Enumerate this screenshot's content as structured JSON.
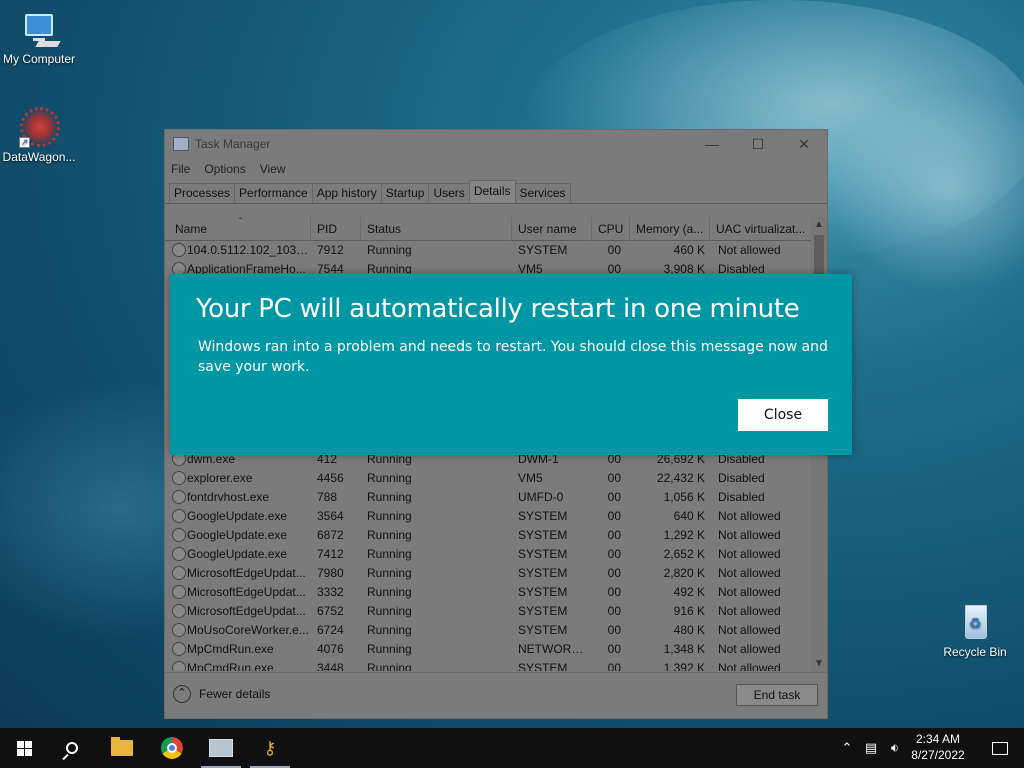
{
  "desktop": {
    "icons": [
      {
        "label": "My Computer"
      },
      {
        "label": "DataWagon..."
      },
      {
        "label": "Recycle Bin"
      }
    ]
  },
  "task_manager": {
    "title": "Task Manager",
    "menu": [
      "File",
      "Options",
      "View"
    ],
    "tabs": [
      "Processes",
      "Performance",
      "App history",
      "Startup",
      "Users",
      "Details",
      "Services"
    ],
    "active_tab": "Details",
    "columns": [
      "Name",
      "PID",
      "Status",
      "User name",
      "CPU",
      "Memory (a...",
      "UAC virtualizat..."
    ],
    "rows": [
      {
        "name": "104.0.5112.102_103.0....",
        "pid": "7912",
        "status": "Running",
        "user": "SYSTEM",
        "cpu": "00",
        "mem": "460 K",
        "uac": "Not allowed"
      },
      {
        "name": "ApplicationFrameHo...",
        "pid": "7544",
        "status": "Running",
        "user": "VM5",
        "cpu": "00",
        "mem": "3,908 K",
        "uac": "Disabled"
      },
      {
        "name": "dwm.exe",
        "pid": "412",
        "status": "Running",
        "user": "DWM-1",
        "cpu": "00",
        "mem": "26,692 K",
        "uac": "Disabled"
      },
      {
        "name": "explorer.exe",
        "pid": "4456",
        "status": "Running",
        "user": "VM5",
        "cpu": "00",
        "mem": "22,432 K",
        "uac": "Disabled"
      },
      {
        "name": "fontdrvhost.exe",
        "pid": "788",
        "status": "Running",
        "user": "UMFD-0",
        "cpu": "00",
        "mem": "1,056 K",
        "uac": "Disabled"
      },
      {
        "name": "GoogleUpdate.exe",
        "pid": "3564",
        "status": "Running",
        "user": "SYSTEM",
        "cpu": "00",
        "mem": "640 K",
        "uac": "Not allowed"
      },
      {
        "name": "GoogleUpdate.exe",
        "pid": "6872",
        "status": "Running",
        "user": "SYSTEM",
        "cpu": "00",
        "mem": "1,292 K",
        "uac": "Not allowed"
      },
      {
        "name": "GoogleUpdate.exe",
        "pid": "7412",
        "status": "Running",
        "user": "SYSTEM",
        "cpu": "00",
        "mem": "2,652 K",
        "uac": "Not allowed"
      },
      {
        "name": "MicrosoftEdgeUpdat...",
        "pid": "7980",
        "status": "Running",
        "user": "SYSTEM",
        "cpu": "00",
        "mem": "2,820 K",
        "uac": "Not allowed"
      },
      {
        "name": "MicrosoftEdgeUpdat...",
        "pid": "3332",
        "status": "Running",
        "user": "SYSTEM",
        "cpu": "00",
        "mem": "492 K",
        "uac": "Not allowed"
      },
      {
        "name": "MicrosoftEdgeUpdat...",
        "pid": "6752",
        "status": "Running",
        "user": "SYSTEM",
        "cpu": "00",
        "mem": "916 K",
        "uac": "Not allowed"
      },
      {
        "name": "MoUsoCoreWorker.e...",
        "pid": "6724",
        "status": "Running",
        "user": "SYSTEM",
        "cpu": "00",
        "mem": "480 K",
        "uac": "Not allowed"
      },
      {
        "name": "MpCmdRun.exe",
        "pid": "4076",
        "status": "Running",
        "user": "NETWORK...",
        "cpu": "00",
        "mem": "1,348 K",
        "uac": "Not allowed"
      },
      {
        "name": "MpCmdRun.exe",
        "pid": "3448",
        "status": "Running",
        "user": "SYSTEM",
        "cpu": "00",
        "mem": "1,392 K",
        "uac": "Not allowed"
      }
    ],
    "footer": {
      "fewer_details": "Fewer details",
      "end_task": "End task"
    }
  },
  "dialog": {
    "title": "Your PC will automatically restart in one minute",
    "message": "Windows ran into a problem and needs to restart. You should close this message now and save your work.",
    "close_label": "Close",
    "bg_color": "#0097a4"
  },
  "taskbar": {
    "time": "2:34 AM",
    "date": "8/27/2022"
  }
}
